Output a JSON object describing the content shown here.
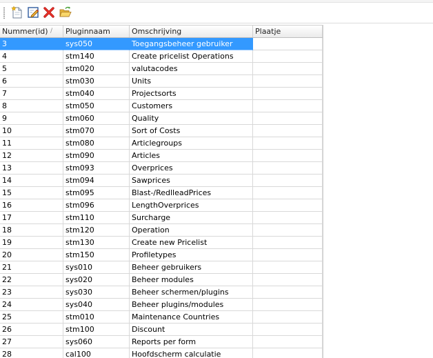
{
  "toolbar": {
    "buttons": [
      {
        "name": "new",
        "icon": "new-document-icon"
      },
      {
        "name": "edit",
        "icon": "edit-icon"
      },
      {
        "name": "delete",
        "icon": "delete-icon"
      },
      {
        "name": "open",
        "icon": "open-folder-icon"
      }
    ]
  },
  "grid": {
    "columns": [
      "Nummer(id)",
      "Pluginnaam",
      "Omschrijving",
      "Plaatje"
    ],
    "sort_indicator": "/",
    "selected_row": 0,
    "selection_color": "#3399ff",
    "rows": [
      {
        "id": "3",
        "plugin": "sys050",
        "description": "Toegangsbeheer gebruiker",
        "image": ""
      },
      {
        "id": "4",
        "plugin": "stm140",
        "description": "Create pricelist Operations",
        "image": ""
      },
      {
        "id": "5",
        "plugin": "stm020",
        "description": "valutacodes",
        "image": ""
      },
      {
        "id": "6",
        "plugin": "stm030",
        "description": "Units",
        "image": ""
      },
      {
        "id": "7",
        "plugin": "stm040",
        "description": "Projectsorts",
        "image": ""
      },
      {
        "id": "8",
        "plugin": "stm050",
        "description": "Customers",
        "image": ""
      },
      {
        "id": "9",
        "plugin": "stm060",
        "description": "Quality",
        "image": ""
      },
      {
        "id": "10",
        "plugin": "stm070",
        "description": "Sort of Costs",
        "image": ""
      },
      {
        "id": "11",
        "plugin": "stm080",
        "description": "Articlegroups",
        "image": ""
      },
      {
        "id": "12",
        "plugin": "stm090",
        "description": "Articles",
        "image": ""
      },
      {
        "id": "13",
        "plugin": "stm093",
        "description": "Overprices",
        "image": ""
      },
      {
        "id": "14",
        "plugin": "stm094",
        "description": "Sawprices",
        "image": ""
      },
      {
        "id": "15",
        "plugin": "stm095",
        "description": "Blast-/RedlleadPrices",
        "image": ""
      },
      {
        "id": "16",
        "plugin": "stm096",
        "description": "LengthOverprices",
        "image": ""
      },
      {
        "id": "17",
        "plugin": "stm110",
        "description": "Surcharge",
        "image": ""
      },
      {
        "id": "18",
        "plugin": "stm120",
        "description": "Operation",
        "image": ""
      },
      {
        "id": "19",
        "plugin": "stm130",
        "description": "Create new Pricelist",
        "image": ""
      },
      {
        "id": "20",
        "plugin": "stm150",
        "description": "Profiletypes",
        "image": ""
      },
      {
        "id": "21",
        "plugin": "sys010",
        "description": "Beheer gebruikers",
        "image": ""
      },
      {
        "id": "22",
        "plugin": "sys020",
        "description": "Beheer modules",
        "image": ""
      },
      {
        "id": "23",
        "plugin": "sys030",
        "description": "Beheer schermen/plugins",
        "image": ""
      },
      {
        "id": "24",
        "plugin": "sys040",
        "description": "Beheer plugins/modules",
        "image": ""
      },
      {
        "id": "25",
        "plugin": "stm010",
        "description": "Maintenance Countries",
        "image": ""
      },
      {
        "id": "26",
        "plugin": "stm100",
        "description": "Discount",
        "image": ""
      },
      {
        "id": "27",
        "plugin": "sys060",
        "description": "Reports per form",
        "image": ""
      },
      {
        "id": "28",
        "plugin": "cal100",
        "description": "Hoofdscherm calculatie",
        "image": ""
      }
    ]
  }
}
